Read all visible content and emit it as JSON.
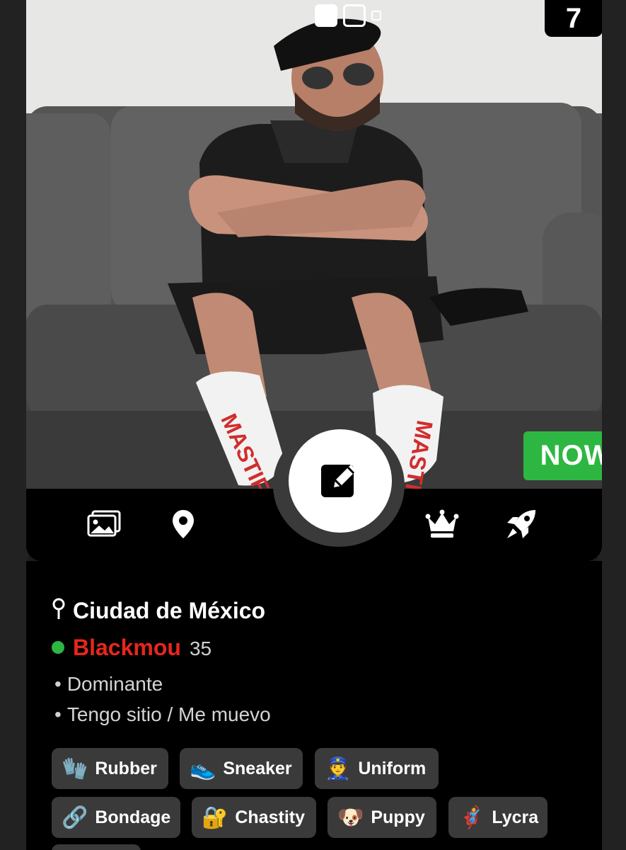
{
  "photo": {
    "counter": "7",
    "status_badge": "NOW",
    "sock_text": "MASTIFF",
    "slides": 3,
    "active_slide": 1
  },
  "toolbar": {
    "items": [
      {
        "icon": "photos-icon"
      },
      {
        "icon": "location-pin-icon"
      },
      {
        "icon": "edit-icon"
      },
      {
        "icon": "crown-icon"
      },
      {
        "icon": "rocket-icon"
      }
    ]
  },
  "profile": {
    "location": "Ciudad de México",
    "username": "Blackmou",
    "age": "35",
    "online": true,
    "attributes": [
      "Dominante",
      "Tengo sitio / Me muevo"
    ]
  },
  "tags": [
    {
      "label": "Rubber",
      "icon": "glove-icon",
      "emoji": "🧤"
    },
    {
      "label": "Sneaker",
      "icon": "sneaker-icon",
      "emoji": "👟"
    },
    {
      "label": "Uniform",
      "icon": "police-officer-icon",
      "emoji": "👮"
    },
    {
      "label": "Bondage",
      "icon": "chain-icon",
      "emoji": "🔗"
    },
    {
      "label": "Chastity",
      "icon": "lock-key-icon",
      "emoji": "🔐"
    },
    {
      "label": "Puppy",
      "icon": "pup-hood-icon",
      "emoji": "🐶"
    },
    {
      "label": "Lycra",
      "icon": "superhero-icon",
      "emoji": "🦸"
    }
  ],
  "colors": {
    "online": "#2db742",
    "username": "#e8261c",
    "tag_bg": "#3a3a3a",
    "now_badge": "#2db742"
  }
}
